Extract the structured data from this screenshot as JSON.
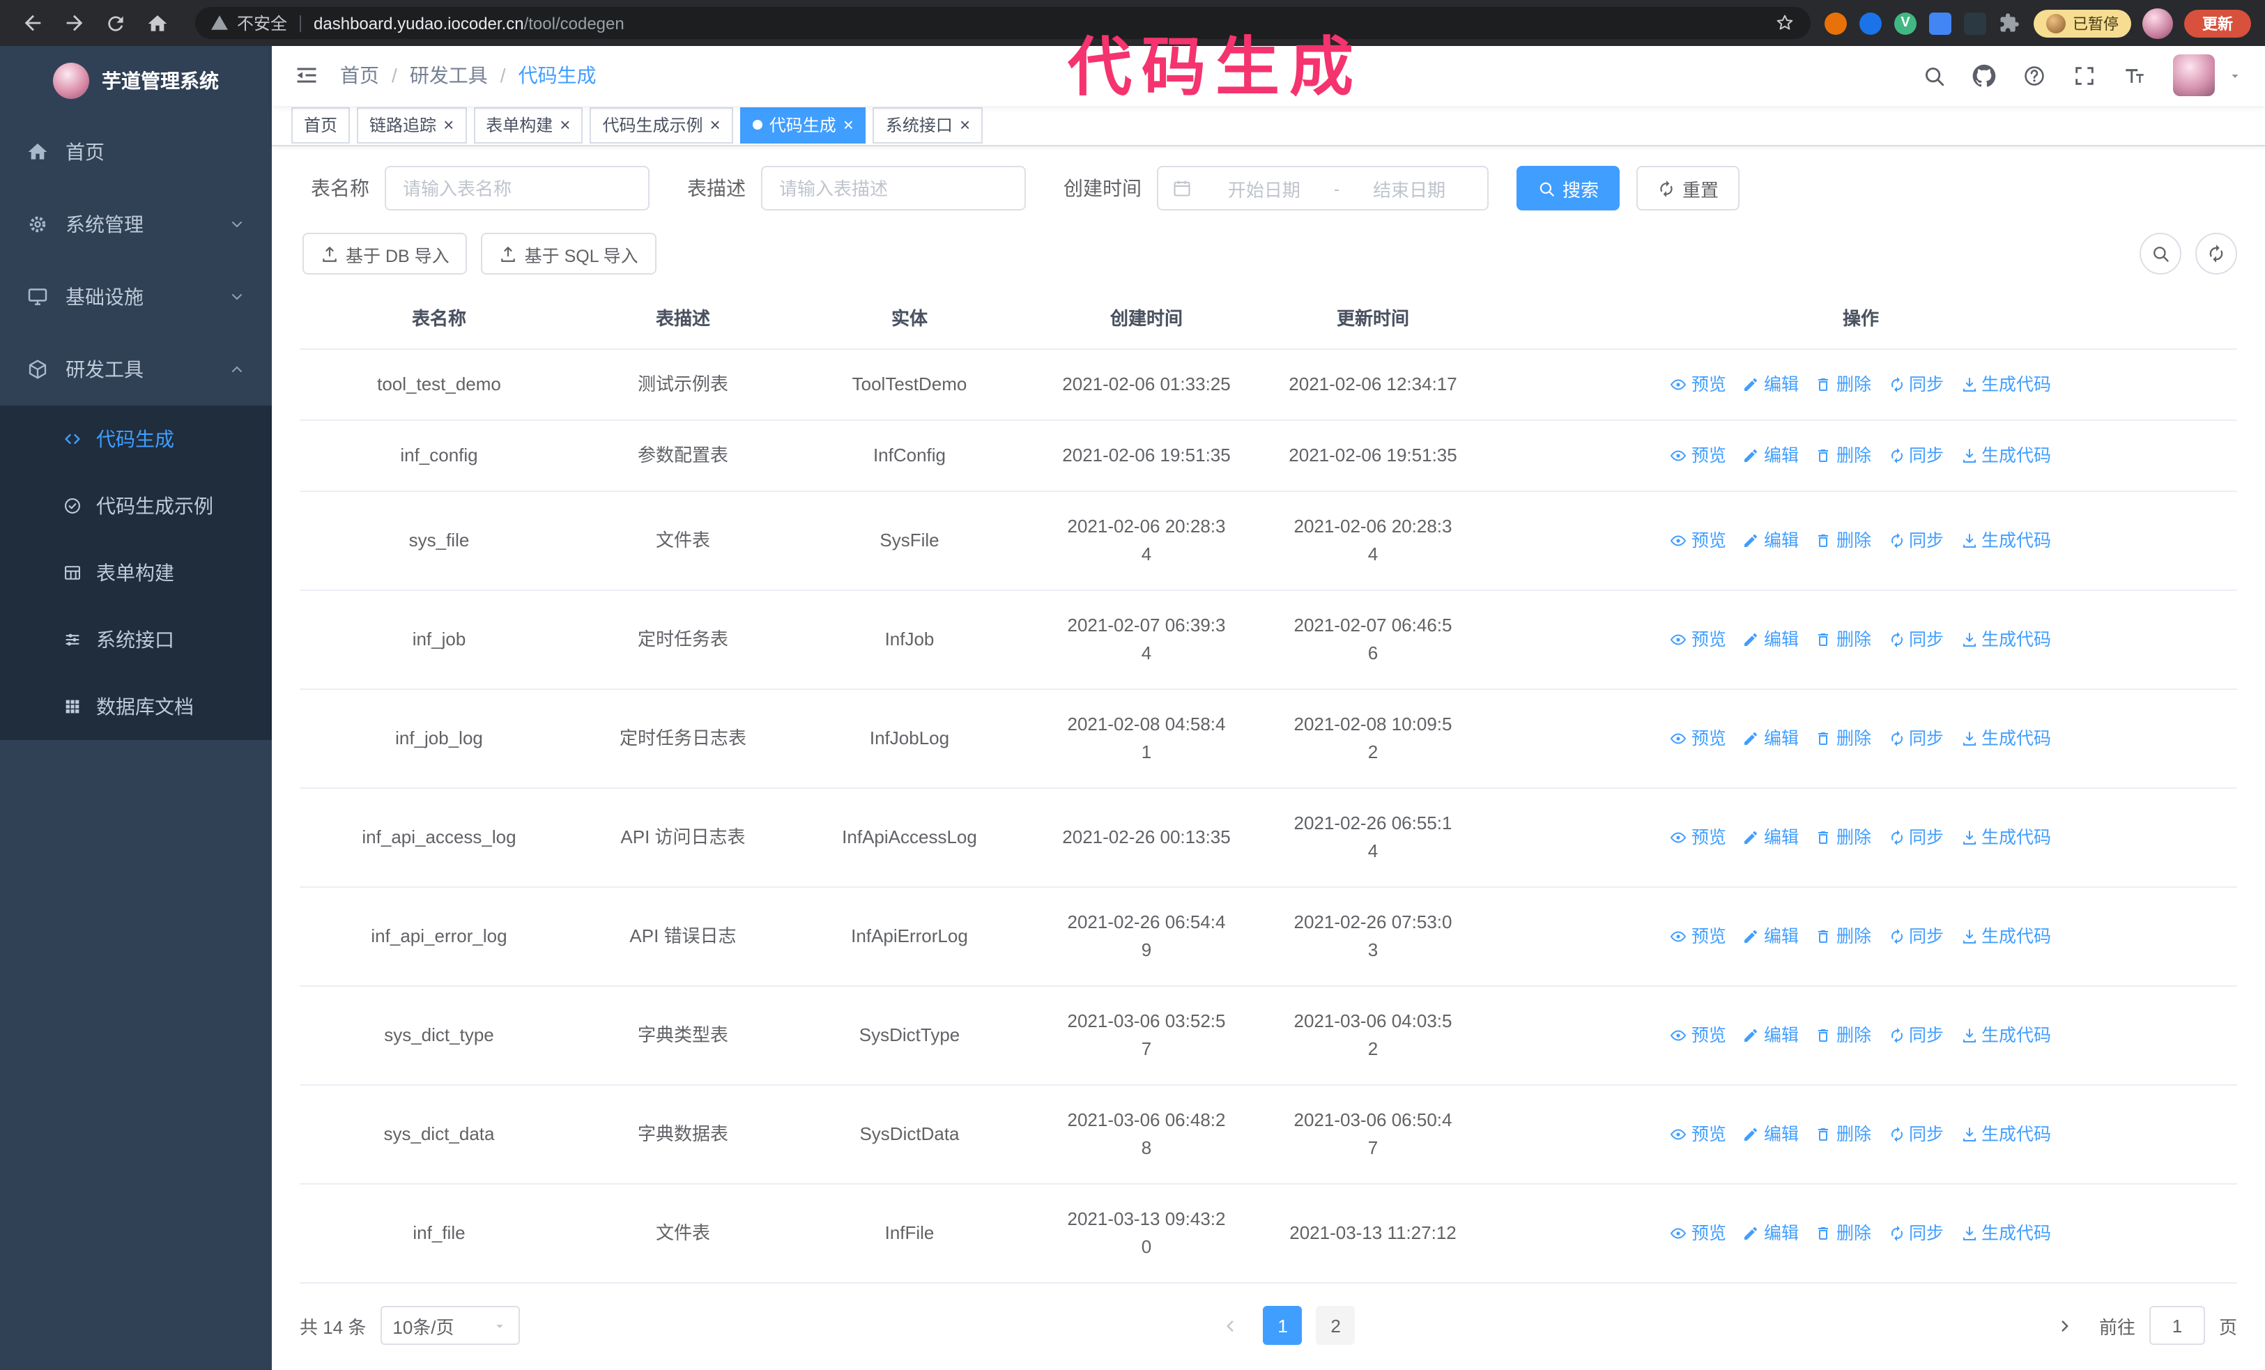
{
  "annotation": {
    "text": "代码生成",
    "color": "#f5336e"
  },
  "browser": {
    "security_label": "不安全",
    "url_host": "dashboard.yudao.iocoder.cn",
    "url_path": "/tool/codegen",
    "vue_badge": "V",
    "paused_badge": "已暂停",
    "update_button": "更新"
  },
  "ui": {
    "close_glyph": "×",
    "breadcrumb_separator": "/"
  },
  "sidebar": {
    "title": "芋道管理系统",
    "menu": [
      {
        "label": "首页"
      },
      {
        "label": "系统管理"
      },
      {
        "label": "基础设施"
      },
      {
        "label": "研发工具"
      }
    ],
    "submenu": [
      {
        "label": "代码生成"
      },
      {
        "label": "代码生成示例"
      },
      {
        "label": "表单构建"
      },
      {
        "label": "系统接口"
      },
      {
        "label": "数据库文档"
      }
    ]
  },
  "header": {
    "breadcrumb": [
      "首页",
      "研发工具",
      "代码生成"
    ]
  },
  "tabs": [
    {
      "label": "首页"
    },
    {
      "label": "链路追踪"
    },
    {
      "label": "表单构建"
    },
    {
      "label": "代码生成示例"
    },
    {
      "label": "代码生成"
    },
    {
      "label": "系统接口"
    }
  ],
  "filters": {
    "table_name_label": "表名称",
    "table_name_placeholder": "请输入表名称",
    "table_desc_label": "表描述",
    "table_desc_placeholder": "请输入表描述",
    "create_time_label": "创建时间",
    "date_start_placeholder": "开始日期",
    "date_separator": "-",
    "date_end_placeholder": "结束日期",
    "search_button": "搜索",
    "reset_button": "重置"
  },
  "toolbar": {
    "import_db": "基于 DB 导入",
    "import_sql": "基于 SQL 导入"
  },
  "table": {
    "columns": [
      "表名称",
      "表描述",
      "实体",
      "创建时间",
      "更新时间",
      "操作"
    ],
    "actions": [
      "预览",
      "编辑",
      "删除",
      "同步",
      "生成代码"
    ],
    "rows": [
      {
        "name": "tool_test_demo",
        "desc": "测试示例表",
        "entity": "ToolTestDemo",
        "created": "2021-02-06 01:33:25",
        "updated": "2021-02-06 12:34:17"
      },
      {
        "name": "inf_config",
        "desc": "参数配置表",
        "entity": "InfConfig",
        "created": "2021-02-06 19:51:35",
        "updated": "2021-02-06 19:51:35"
      },
      {
        "name": "sys_file",
        "desc": "文件表",
        "entity": "SysFile",
        "created": "2021-02-06 20:28:3\n4",
        "updated": "2021-02-06 20:28:3\n4"
      },
      {
        "name": "inf_job",
        "desc": "定时任务表",
        "entity": "InfJob",
        "created": "2021-02-07 06:39:3\n4",
        "updated": "2021-02-07 06:46:5\n6"
      },
      {
        "name": "inf_job_log",
        "desc": "定时任务日志表",
        "entity": "InfJobLog",
        "created": "2021-02-08 04:58:4\n1",
        "updated": "2021-02-08 10:09:5\n2"
      },
      {
        "name": "inf_api_access_log",
        "desc": "API 访问日志表",
        "entity": "InfApiAccessLog",
        "created": "2021-02-26 00:13:35",
        "updated": "2021-02-26 06:55:1\n4"
      },
      {
        "name": "inf_api_error_log",
        "desc": "API 错误日志",
        "entity": "InfApiErrorLog",
        "created": "2021-02-26 06:54:4\n9",
        "updated": "2021-02-26 07:53:0\n3"
      },
      {
        "name": "sys_dict_type",
        "desc": "字典类型表",
        "entity": "SysDictType",
        "created": "2021-03-06 03:52:5\n7",
        "updated": "2021-03-06 04:03:5\n2"
      },
      {
        "name": "sys_dict_data",
        "desc": "字典数据表",
        "entity": "SysDictData",
        "created": "2021-03-06 06:48:2\n8",
        "updated": "2021-03-06 06:50:4\n7"
      },
      {
        "name": "inf_file",
        "desc": "文件表",
        "entity": "InfFile",
        "created": "2021-03-13 09:43:2\n0",
        "updated": "2021-03-13 11:27:12"
      }
    ]
  },
  "pagination": {
    "total": "共 14 条",
    "page_size": "10条/页",
    "pages": [
      "1",
      "2"
    ],
    "goto_label": "前往",
    "goto_value": "1",
    "goto_suffix": "页"
  }
}
